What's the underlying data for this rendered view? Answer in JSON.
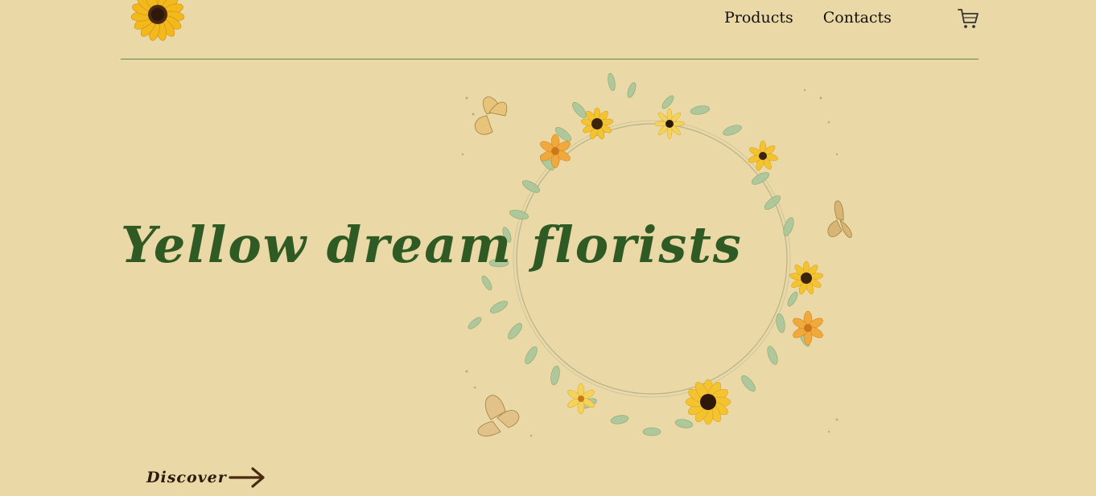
{
  "header": {
    "logo": "sunflower-logo",
    "nav": [
      {
        "label": "Products"
      },
      {
        "label": "Contacts"
      }
    ],
    "cart_icon": "shopping-cart-icon"
  },
  "hero": {
    "title": "Yellow dream florists",
    "decoration": "sunflower-wreath-illustration",
    "discover_label": "Discover",
    "discover_icon": "arrow-right-icon"
  },
  "colors": {
    "background": "#ead8a6",
    "title": "#2f5a24",
    "divider": "#5d8a52",
    "discover": "#2a1a10",
    "arrow": "#4a2a12"
  }
}
